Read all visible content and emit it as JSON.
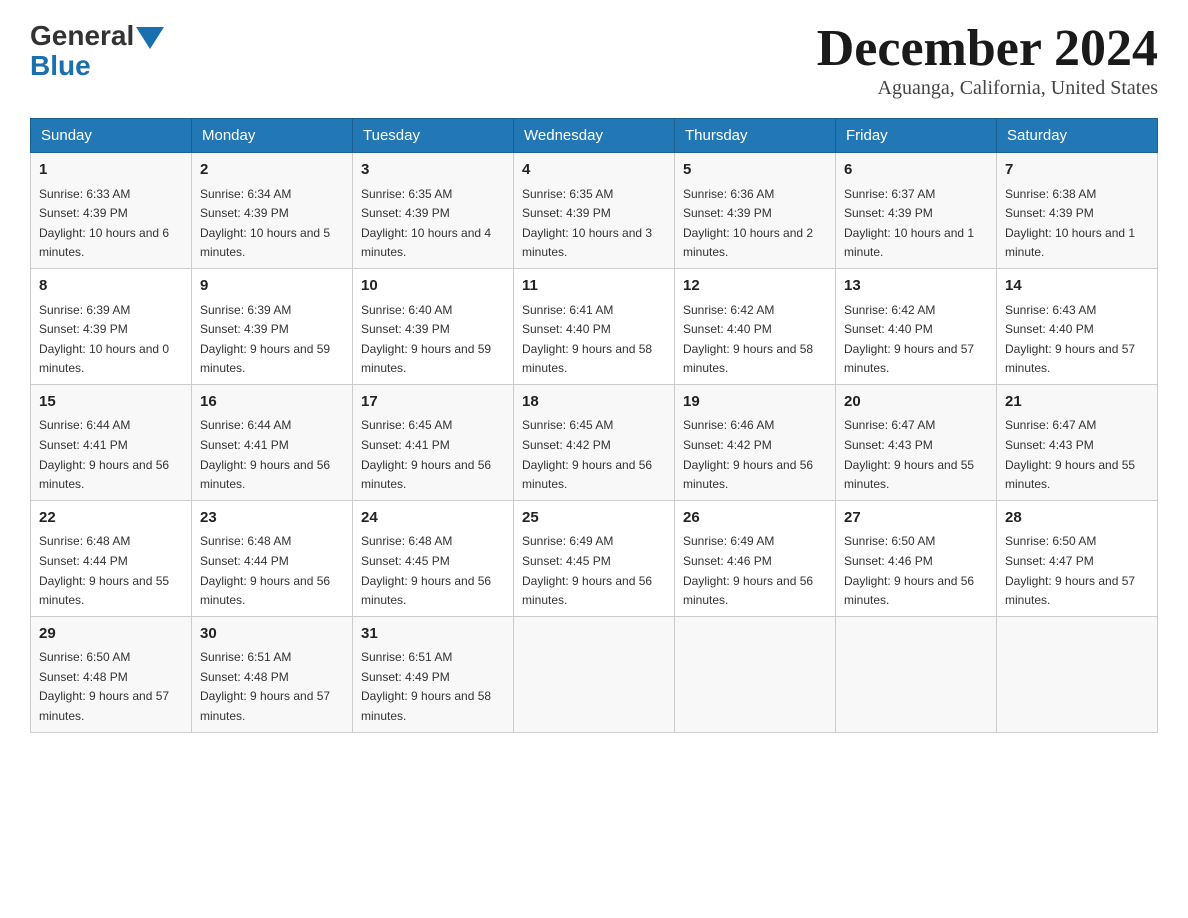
{
  "header": {
    "title": "December 2024",
    "location": "Aguanga, California, United States",
    "logo_general": "General",
    "logo_blue": "Blue"
  },
  "weekdays": [
    "Sunday",
    "Monday",
    "Tuesday",
    "Wednesday",
    "Thursday",
    "Friday",
    "Saturday"
  ],
  "weeks": [
    [
      {
        "day": "1",
        "sunrise": "6:33 AM",
        "sunset": "4:39 PM",
        "daylight": "10 hours and 6 minutes."
      },
      {
        "day": "2",
        "sunrise": "6:34 AM",
        "sunset": "4:39 PM",
        "daylight": "10 hours and 5 minutes."
      },
      {
        "day": "3",
        "sunrise": "6:35 AM",
        "sunset": "4:39 PM",
        "daylight": "10 hours and 4 minutes."
      },
      {
        "day": "4",
        "sunrise": "6:35 AM",
        "sunset": "4:39 PM",
        "daylight": "10 hours and 3 minutes."
      },
      {
        "day": "5",
        "sunrise": "6:36 AM",
        "sunset": "4:39 PM",
        "daylight": "10 hours and 2 minutes."
      },
      {
        "day": "6",
        "sunrise": "6:37 AM",
        "sunset": "4:39 PM",
        "daylight": "10 hours and 1 minute."
      },
      {
        "day": "7",
        "sunrise": "6:38 AM",
        "sunset": "4:39 PM",
        "daylight": "10 hours and 1 minute."
      }
    ],
    [
      {
        "day": "8",
        "sunrise": "6:39 AM",
        "sunset": "4:39 PM",
        "daylight": "10 hours and 0 minutes."
      },
      {
        "day": "9",
        "sunrise": "6:39 AM",
        "sunset": "4:39 PM",
        "daylight": "9 hours and 59 minutes."
      },
      {
        "day": "10",
        "sunrise": "6:40 AM",
        "sunset": "4:39 PM",
        "daylight": "9 hours and 59 minutes."
      },
      {
        "day": "11",
        "sunrise": "6:41 AM",
        "sunset": "4:40 PM",
        "daylight": "9 hours and 58 minutes."
      },
      {
        "day": "12",
        "sunrise": "6:42 AM",
        "sunset": "4:40 PM",
        "daylight": "9 hours and 58 minutes."
      },
      {
        "day": "13",
        "sunrise": "6:42 AM",
        "sunset": "4:40 PM",
        "daylight": "9 hours and 57 minutes."
      },
      {
        "day": "14",
        "sunrise": "6:43 AM",
        "sunset": "4:40 PM",
        "daylight": "9 hours and 57 minutes."
      }
    ],
    [
      {
        "day": "15",
        "sunrise": "6:44 AM",
        "sunset": "4:41 PM",
        "daylight": "9 hours and 56 minutes."
      },
      {
        "day": "16",
        "sunrise": "6:44 AM",
        "sunset": "4:41 PM",
        "daylight": "9 hours and 56 minutes."
      },
      {
        "day": "17",
        "sunrise": "6:45 AM",
        "sunset": "4:41 PM",
        "daylight": "9 hours and 56 minutes."
      },
      {
        "day": "18",
        "sunrise": "6:45 AM",
        "sunset": "4:42 PM",
        "daylight": "9 hours and 56 minutes."
      },
      {
        "day": "19",
        "sunrise": "6:46 AM",
        "sunset": "4:42 PM",
        "daylight": "9 hours and 56 minutes."
      },
      {
        "day": "20",
        "sunrise": "6:47 AM",
        "sunset": "4:43 PM",
        "daylight": "9 hours and 55 minutes."
      },
      {
        "day": "21",
        "sunrise": "6:47 AM",
        "sunset": "4:43 PM",
        "daylight": "9 hours and 55 minutes."
      }
    ],
    [
      {
        "day": "22",
        "sunrise": "6:48 AM",
        "sunset": "4:44 PM",
        "daylight": "9 hours and 55 minutes."
      },
      {
        "day": "23",
        "sunrise": "6:48 AM",
        "sunset": "4:44 PM",
        "daylight": "9 hours and 56 minutes."
      },
      {
        "day": "24",
        "sunrise": "6:48 AM",
        "sunset": "4:45 PM",
        "daylight": "9 hours and 56 minutes."
      },
      {
        "day": "25",
        "sunrise": "6:49 AM",
        "sunset": "4:45 PM",
        "daylight": "9 hours and 56 minutes."
      },
      {
        "day": "26",
        "sunrise": "6:49 AM",
        "sunset": "4:46 PM",
        "daylight": "9 hours and 56 minutes."
      },
      {
        "day": "27",
        "sunrise": "6:50 AM",
        "sunset": "4:46 PM",
        "daylight": "9 hours and 56 minutes."
      },
      {
        "day": "28",
        "sunrise": "6:50 AM",
        "sunset": "4:47 PM",
        "daylight": "9 hours and 57 minutes."
      }
    ],
    [
      {
        "day": "29",
        "sunrise": "6:50 AM",
        "sunset": "4:48 PM",
        "daylight": "9 hours and 57 minutes."
      },
      {
        "day": "30",
        "sunrise": "6:51 AM",
        "sunset": "4:48 PM",
        "daylight": "9 hours and 57 minutes."
      },
      {
        "day": "31",
        "sunrise": "6:51 AM",
        "sunset": "4:49 PM",
        "daylight": "9 hours and 58 minutes."
      },
      null,
      null,
      null,
      null
    ]
  ],
  "labels": {
    "sunrise": "Sunrise:",
    "sunset": "Sunset:",
    "daylight": "Daylight:"
  }
}
